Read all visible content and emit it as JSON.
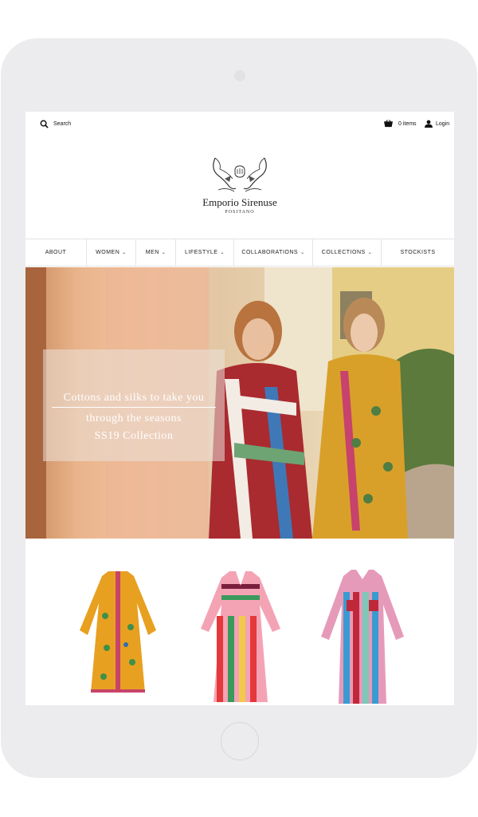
{
  "header": {
    "search_label": "Search",
    "cart_label": "0 items",
    "login_label": "Login"
  },
  "logo": {
    "brand": "Emporio Sirenuse",
    "subtitle": "POSITANO"
  },
  "nav": {
    "items": [
      {
        "label": "ABOUT",
        "has_dropdown": false
      },
      {
        "label": "WOMEN",
        "has_dropdown": true
      },
      {
        "label": "MEN",
        "has_dropdown": true
      },
      {
        "label": "LIFESTYLE",
        "has_dropdown": true
      },
      {
        "label": "COLLABORATIONS",
        "has_dropdown": true
      },
      {
        "label": "COLLECTIONS",
        "has_dropdown": true
      },
      {
        "label": "STOCKISTS",
        "has_dropdown": false
      }
    ]
  },
  "hero": {
    "line1": "Cottons and silks to take you",
    "line2": "through the seasons",
    "line3": "SS19 Collection"
  },
  "products": [
    {
      "name": "yellow-floral-kaftan-dress",
      "colors": [
        "#e8a021",
        "#c8436a",
        "#3f8f4a"
      ]
    },
    {
      "name": "multicolor-striped-maxi-dress",
      "colors": [
        "#e5383b",
        "#f4a3b5",
        "#3a9a5b",
        "#f2c94c"
      ]
    },
    {
      "name": "pastel-striped-shirt-dress",
      "colors": [
        "#3a9bd1",
        "#c0283a",
        "#e69ab9",
        "#7fc7b7"
      ]
    }
  ],
  "colors": {
    "device_frame": "#ececee",
    "screen_bg": "#ffffff",
    "text": "#222222"
  }
}
